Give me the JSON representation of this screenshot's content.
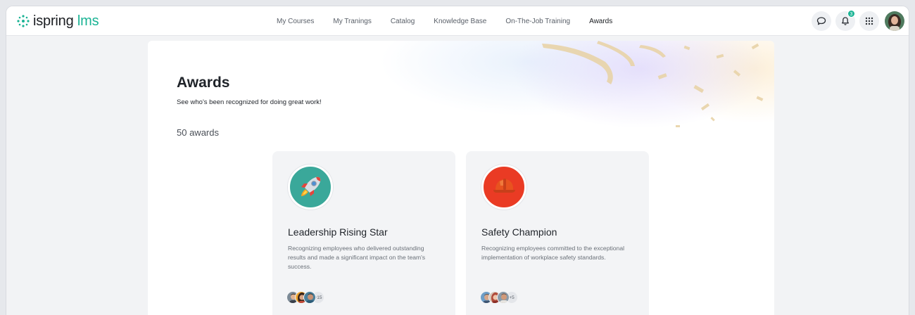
{
  "header": {
    "logo_text": "ispring",
    "logo_suffix": "lms",
    "nav": [
      {
        "label": "My Courses"
      },
      {
        "label": "My Tranings"
      },
      {
        "label": "Catalog"
      },
      {
        "label": "Knowledge Base"
      },
      {
        "label": "On-The-Job Training"
      },
      {
        "label": "Awards",
        "active": true
      }
    ],
    "notifications_count": "3"
  },
  "page": {
    "title": "Awards",
    "subtitle": "See who's been recognized for doing great work!",
    "count_label": "50 awards"
  },
  "awards": [
    {
      "title": "Leadership Rising Star",
      "description": "Recognizing employees who delivered outstanding results and made a significant impact on the team's success.",
      "icon": "rocket-icon",
      "icon_bg": "#3aa89a",
      "more_count": "+15"
    },
    {
      "title": "Safety Champion",
      "description": "Recognizing employees committed to the exceptional implementation of workplace safety standards.",
      "icon": "hard-hat-icon",
      "icon_bg": "#ea3b24",
      "more_count": "+5"
    }
  ],
  "colors": {
    "brand": "#1ab394",
    "page_bg": "#f2f3f5",
    "card_bg": "#f3f4f6"
  }
}
